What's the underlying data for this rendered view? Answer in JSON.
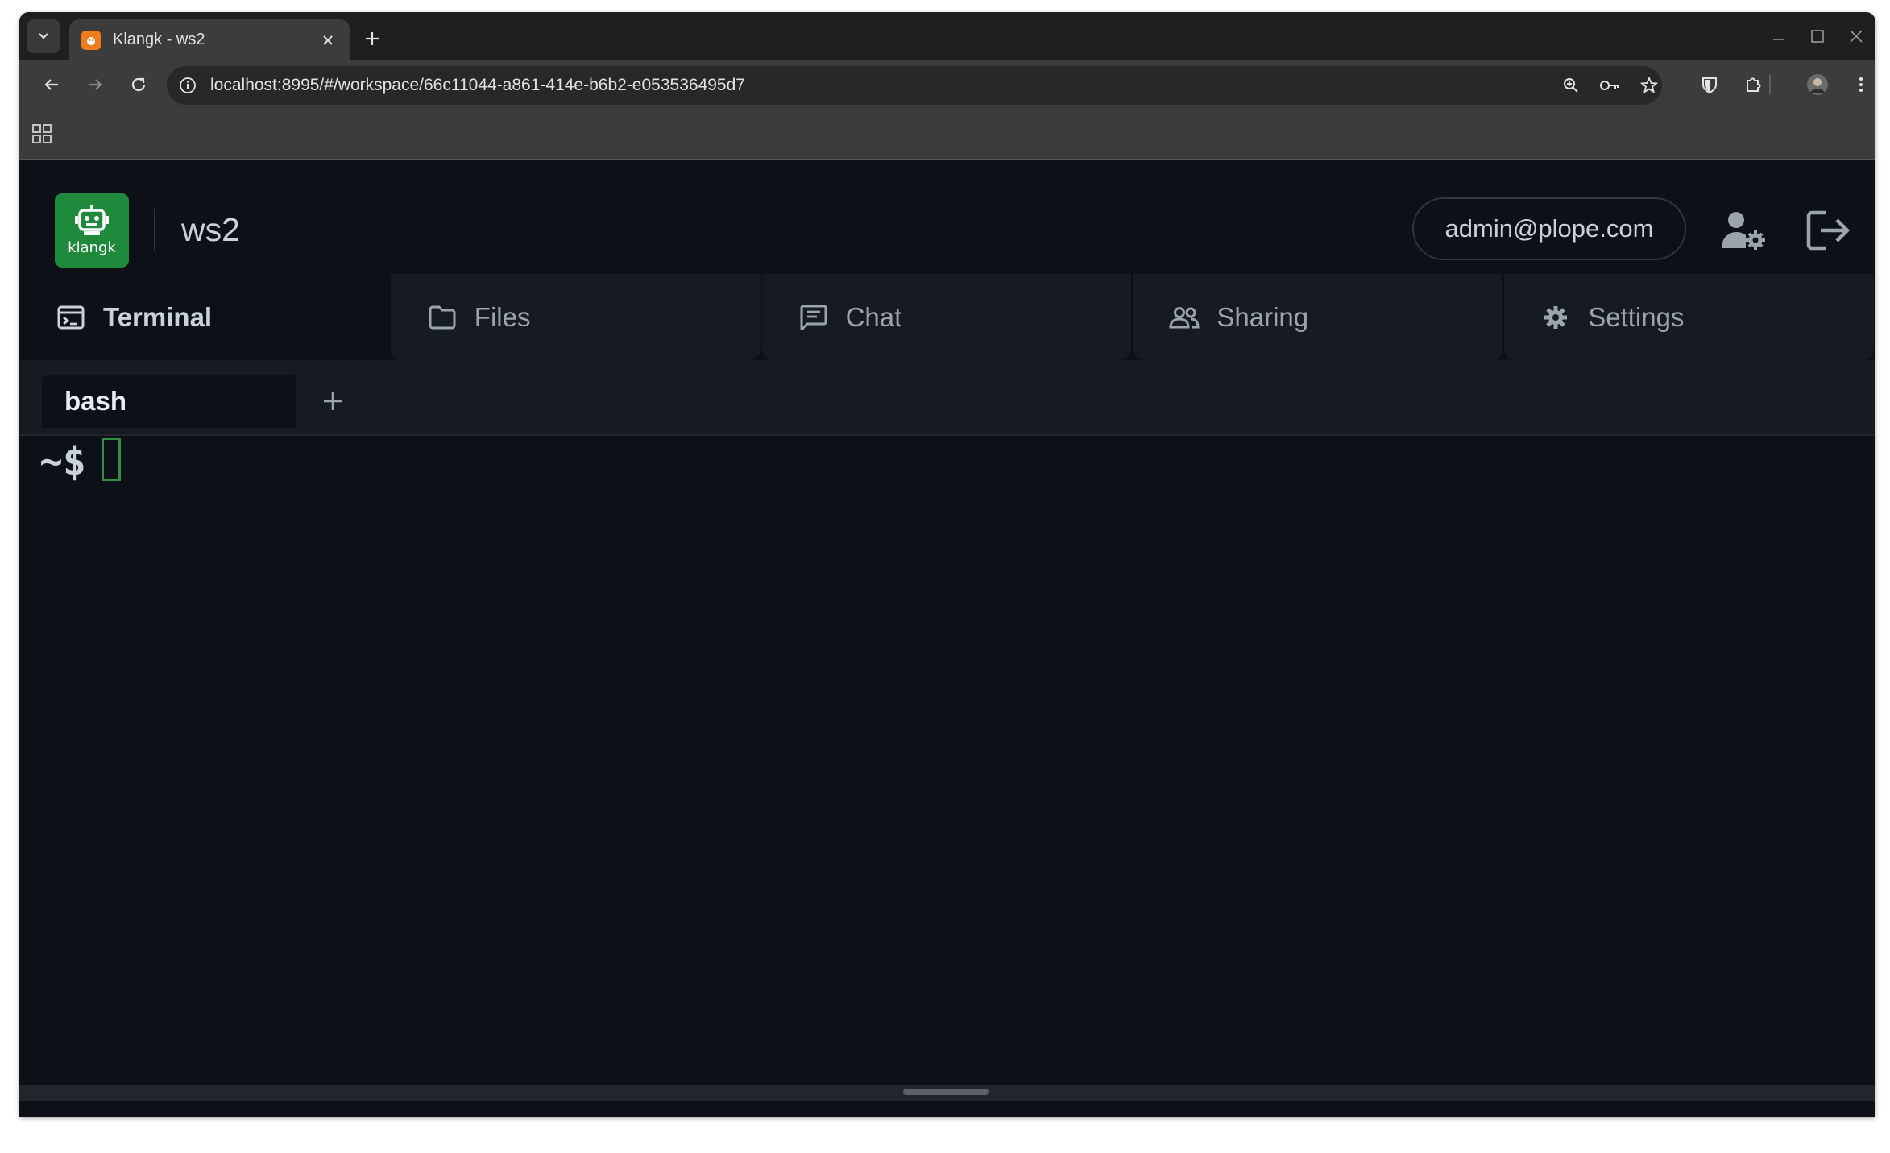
{
  "browser": {
    "tab_title": "Klangk - ws2",
    "url": "localhost:8995/#/workspace/66c11044-a861-414e-b6b2-e053536495d7",
    "icons": [
      "tab-search-icon",
      "favicon-icon",
      "close-icon",
      "plus-icon",
      "minimize-icon",
      "maximize-icon",
      "close-window-icon",
      "back-arrow-icon",
      "forward-arrow-icon",
      "reload-icon",
      "site-info-icon",
      "zoom-icon",
      "key-icon",
      "star-icon",
      "shield-icon",
      "puzzle-icon",
      "profile-avatar-icon",
      "kebab-menu-icon",
      "apps-grid-icon"
    ]
  },
  "header": {
    "logo_text": "klangk",
    "workspace_name": "ws2",
    "user_email": "admin@plope.com",
    "icons": [
      "robot-icon",
      "user-settings-icon",
      "logout-icon"
    ]
  },
  "nav": {
    "tabs": [
      {
        "label": "Terminal",
        "icon": "terminal-icon",
        "active": true
      },
      {
        "label": "Files",
        "icon": "folder-icon",
        "active": false
      },
      {
        "label": "Chat",
        "icon": "chat-icon",
        "active": false
      },
      {
        "label": "Sharing",
        "icon": "users-icon",
        "active": false
      },
      {
        "label": "Settings",
        "icon": "gear-icon",
        "active": false
      }
    ]
  },
  "terminal": {
    "session_tab": "bash",
    "prompt": "~$"
  },
  "colors": {
    "accent_green": "#1f8a3c",
    "cursor_green": "#3fb950",
    "background": "#0d1117",
    "favicon_orange": "#f07c1d"
  }
}
